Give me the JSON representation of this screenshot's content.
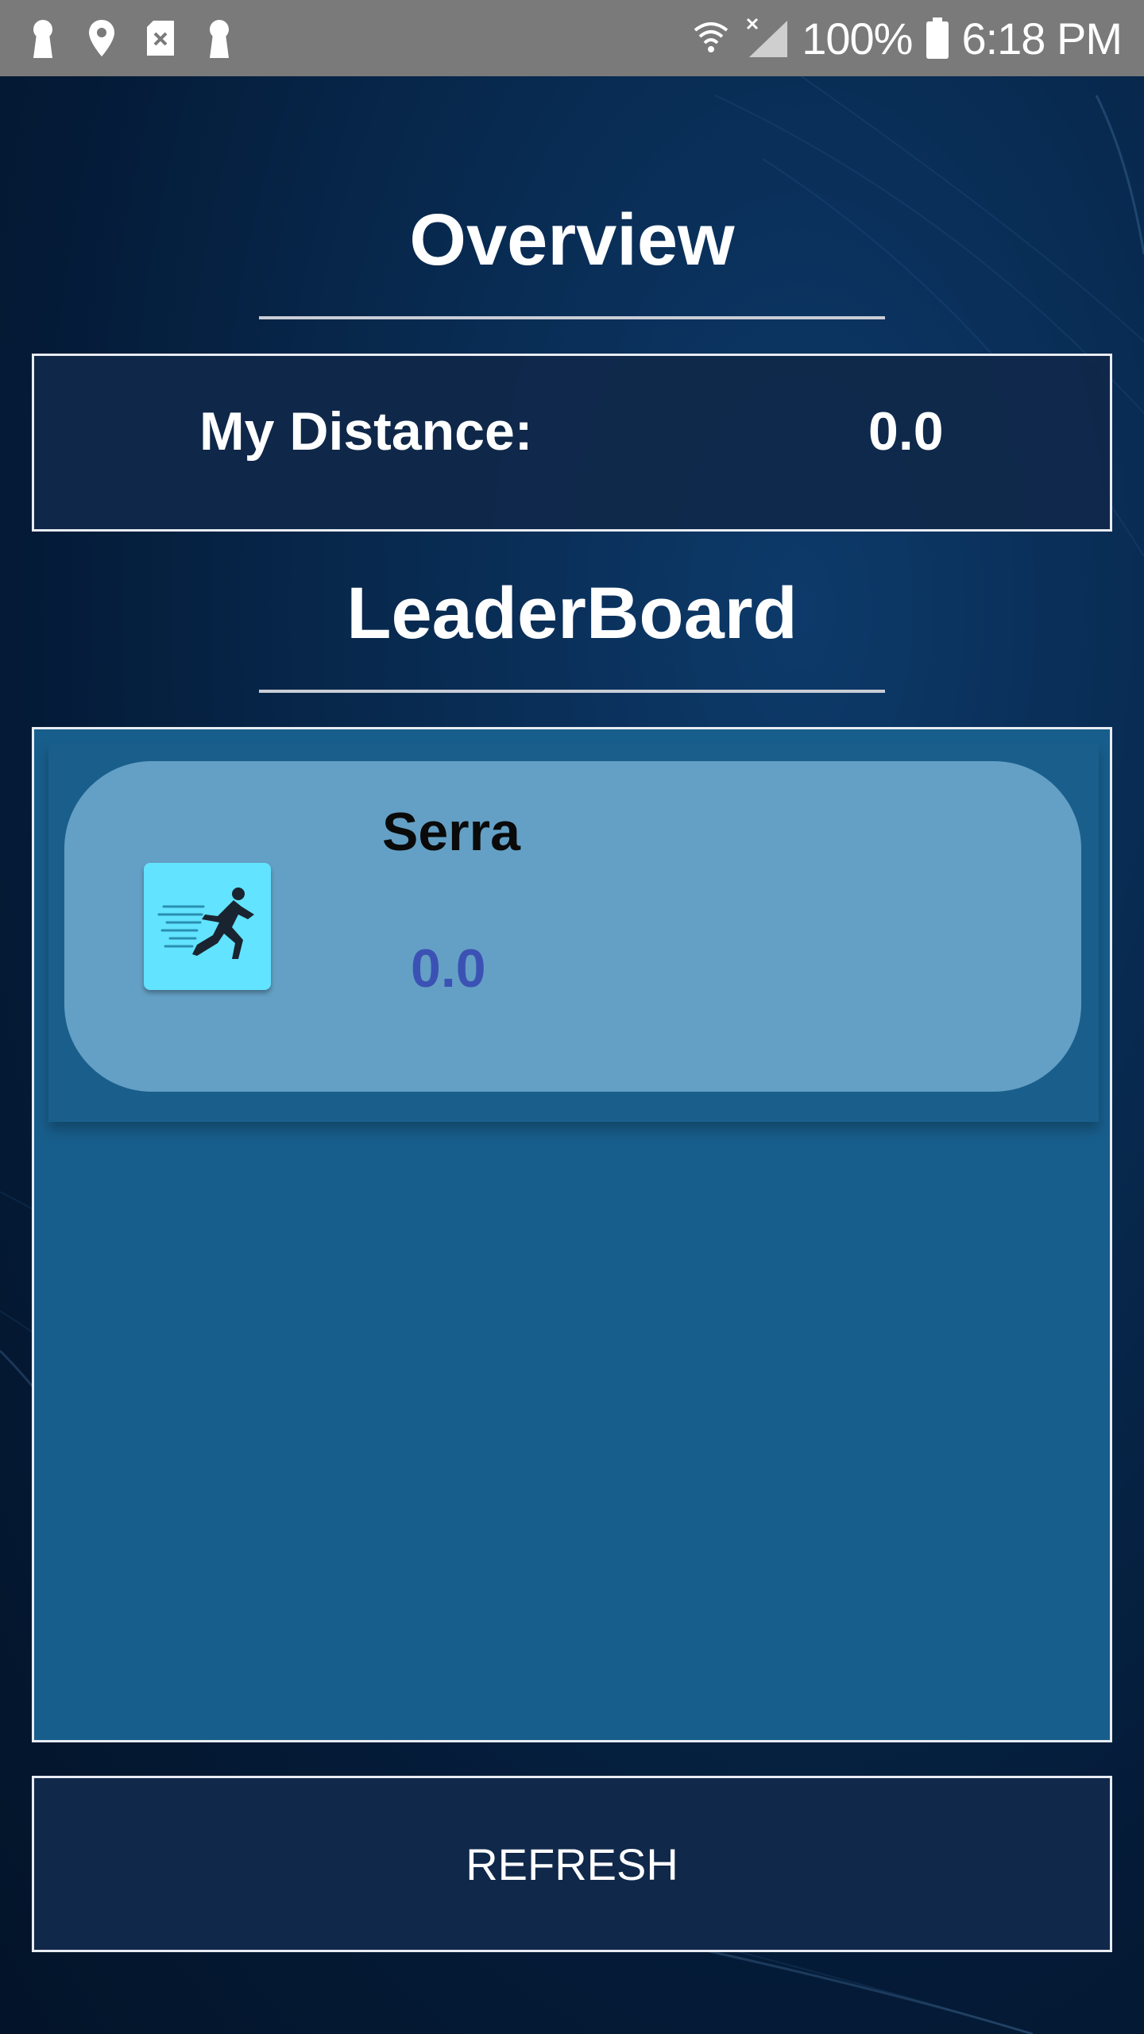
{
  "status_bar": {
    "battery": "100%",
    "time": "6:18 PM",
    "left_icons": [
      "keyhole-icon",
      "location-pin-icon",
      "sim-card-icon",
      "keyhole-icon"
    ],
    "right_icons": [
      "wifi-icon",
      "cell-signal-icon",
      "battery-icon"
    ]
  },
  "overview": {
    "title": "Overview",
    "distance_label": "My Distance:",
    "distance_value": "0.0"
  },
  "leaderboard": {
    "title": "LeaderBoard",
    "entries": [
      {
        "name": "Serra",
        "value": "0.0",
        "avatar_icon": "runner-icon"
      }
    ]
  },
  "actions": {
    "refresh_label": "REFRESH"
  },
  "colors": {
    "status_bar": "#7a7a7a",
    "card": "#64a0c5",
    "list_bg": "#185e8c",
    "panel": "#10284a",
    "value_text": "#3b52b4",
    "avatar_bg": "#62e3ff"
  }
}
